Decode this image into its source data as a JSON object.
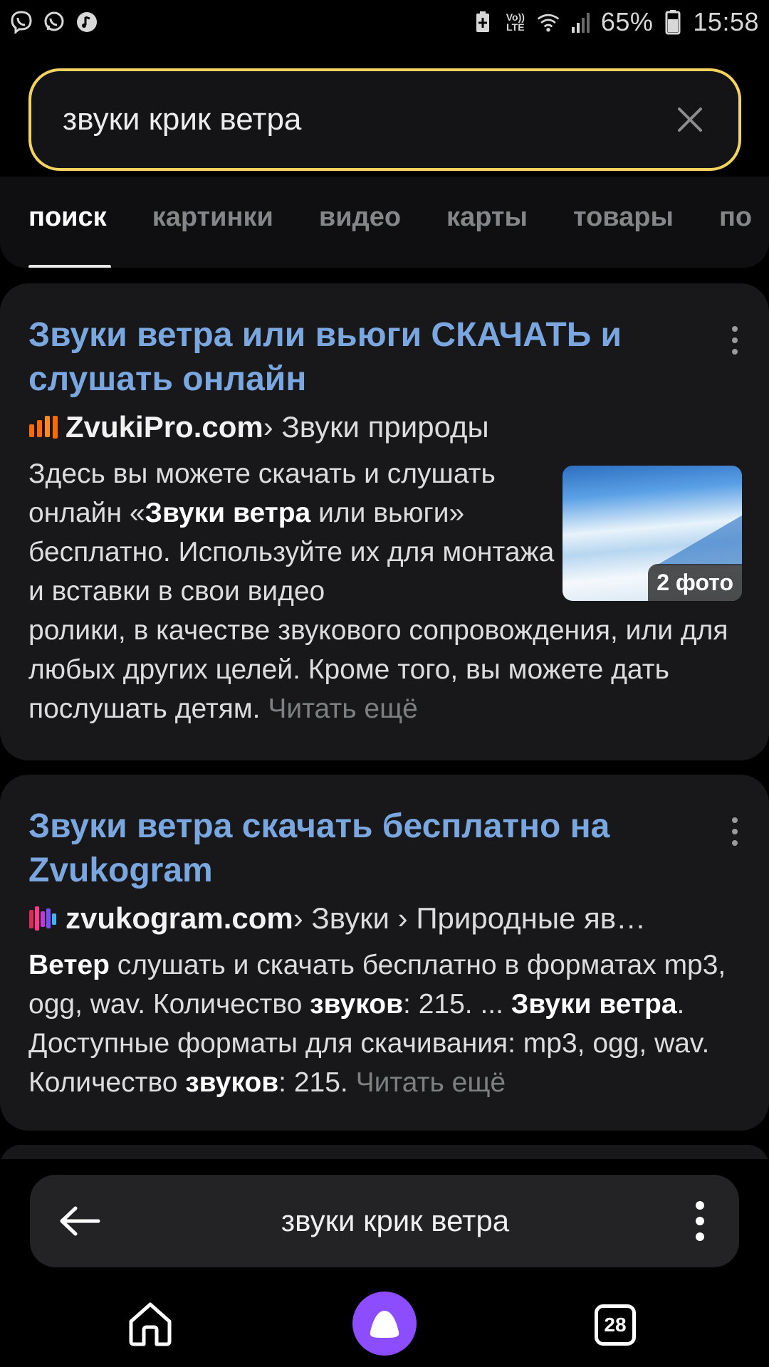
{
  "status_bar": {
    "battery_percent": "65%",
    "time": "15:58",
    "volte_top": "Vo))",
    "volte_bottom": "LTE"
  },
  "search": {
    "query": "звуки крик ветра"
  },
  "tabs": [
    {
      "label": "поиск",
      "active": true
    },
    {
      "label": "картинки",
      "active": false
    },
    {
      "label": "видео",
      "active": false
    },
    {
      "label": "карты",
      "active": false
    },
    {
      "label": "товары",
      "active": false
    },
    {
      "label": "по",
      "active": false
    }
  ],
  "results": [
    {
      "title": "Звуки ветра или вьюги СКАЧАТЬ и слушать онлайн",
      "site": "ZvukiPro.com",
      "breadcrumb": " › Звуки природы",
      "snippet_parts": [
        "Здесь вы можете скачать и слушать онлайн «",
        "Звуки ветра",
        " или вьюги» бесплатно. Используйте их для монтажа и вставки в свои видео ролики, в качестве звукового сопровождения, или для любых других целей. Кроме того, вы можете дать послушать детям. "
      ],
      "read_more": "Читать ещё",
      "thumb_badge": "2 фото"
    },
    {
      "title": "Звуки ветра скачать бесплатно на Zvukogram",
      "site": "zvukogram.com",
      "breadcrumb": " › Звуки › Природные яв…",
      "snippet_parts": [
        "Ветер",
        " слушать и скачать бесплатно в форматах mp3, ogg, wav. Количество ",
        "звуков",
        ": 215. ... ",
        "Звуки ветра",
        ". Доступные форматы для скачивания: mp3, ogg, wav. Количество ",
        "звуков",
        ": 215. "
      ],
      "read_more": "Читать ещё"
    }
  ],
  "omnibox": {
    "text": "звуки крик ветра"
  },
  "nav": {
    "tabs_count": "28"
  },
  "colors": {
    "search_border": "#f5d35f",
    "link_title": "#7aa7e0",
    "alice": "#8b4dff",
    "zvukipro_bars": "#ff6a00"
  }
}
